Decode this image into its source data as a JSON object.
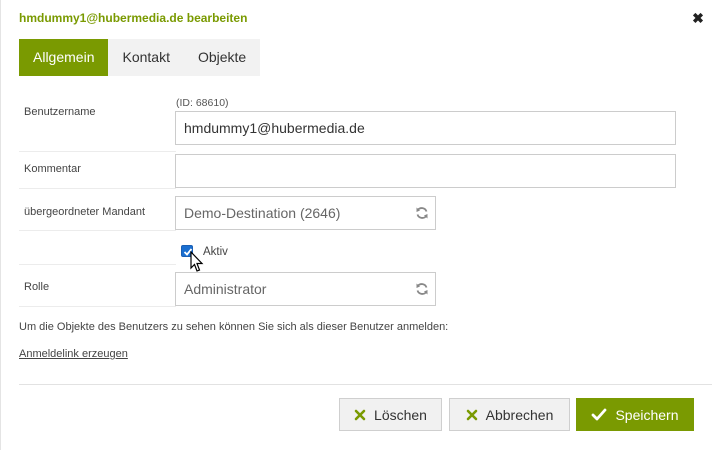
{
  "dialog": {
    "title": "hmdummy1@hubermedia.de bearbeiten",
    "close_symbol": "✖"
  },
  "tabs": [
    {
      "label": "Allgemein",
      "active": true
    },
    {
      "label": "Kontakt",
      "active": false
    },
    {
      "label": "Objekte",
      "active": false
    }
  ],
  "form": {
    "username": {
      "label": "Benutzername",
      "id_text": "(ID: 68610)",
      "value": "hmdummy1@hubermedia.de"
    },
    "comment": {
      "label": "Kommentar",
      "value": ""
    },
    "parent_client": {
      "label": "übergeordneter Mandant",
      "value": "Demo-Destination (2646)"
    },
    "active": {
      "label": "Aktiv",
      "checked": true
    },
    "role": {
      "label": "Rolle",
      "value": "Administrator"
    }
  },
  "hint_text": "Um die Objekte des Benutzers zu sehen können Sie sich als dieser Benutzer anmelden:",
  "login_link": "Anmeldelink erzeugen",
  "buttons": {
    "delete": "Löschen",
    "cancel": "Abbrechen",
    "save": "Speichern"
  },
  "colors": {
    "accent": "#7a9a01",
    "checkbox": "#1a6fd1"
  },
  "icons": {
    "close": "close-icon",
    "refresh": "refresh-icon",
    "check": "check-icon",
    "x": "x-icon",
    "cursor": "mouse-cursor-icon"
  }
}
